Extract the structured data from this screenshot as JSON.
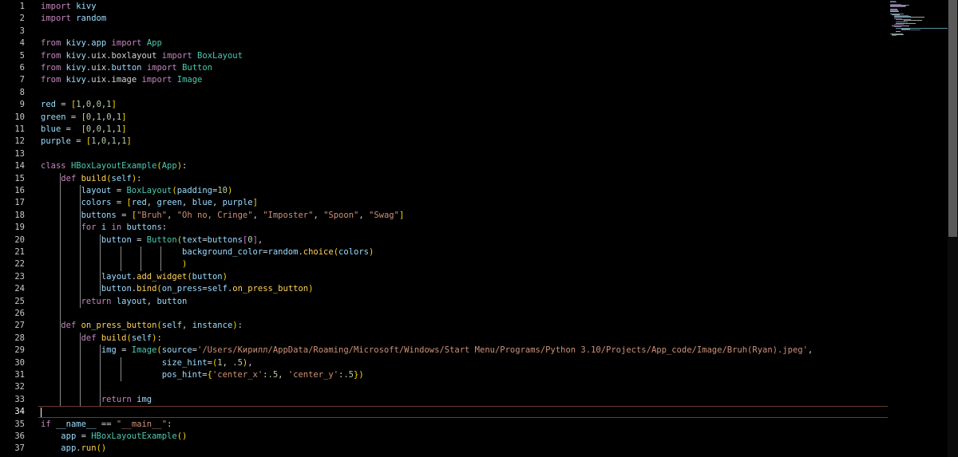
{
  "colors": {
    "background": "#000000",
    "keyword": "#c586c0",
    "function": "#ffd35a",
    "class": "#4ec9b0",
    "variable": "#9cdcfe",
    "number": "#b5cea8",
    "string": "#ce9178",
    "current_line_border": "#6b3a2c"
  },
  "editor": {
    "language": "python",
    "current_line": 34,
    "line_numbers": [
      "1",
      "2",
      "3",
      "4",
      "5",
      "6",
      "7",
      "8",
      "9",
      "10",
      "11",
      "12",
      "13",
      "14",
      "15",
      "16",
      "17",
      "18",
      "19",
      "20",
      "21",
      "22",
      "23",
      "24",
      "25",
      "26",
      "27",
      "28",
      "29",
      "30",
      "31",
      "32",
      "33",
      "34",
      "35",
      "36",
      "37"
    ],
    "lines": [
      "import kivy",
      "import random",
      "",
      "from kivy.app import App",
      "from kivy.uix.boxlayout import BoxLayout",
      "from kivy.uix.button import Button",
      "from kivy.uix.image import Image",
      "",
      "red = [1,0,0,1]",
      "green = [0,1,0,1]",
      "blue =  [0,0,1,1]",
      "purple = [1,0,1,1]",
      "",
      "class HBoxLayoutExample(App):",
      "    def build(self):",
      "        layout = BoxLayout(padding=10)",
      "        colors = [red, green, blue, purple]",
      "        buttons = [\"Bruh\", \"Oh no, Cringe\", \"Imposter\", \"Spoon\", \"Swag\"]",
      "        for i in buttons:",
      "            button = Button(text=buttons[0],",
      "                            background_color=random.choice(colors)",
      "                            )",
      "            layout.add_widget(button)",
      "            button.bind(on_press=self.on_press_button)",
      "        return layout, button",
      "",
      "    def on_press_button(self, instance):",
      "        def build(self):",
      "            img = Image(source='/Users/Кирилл/AppData/Roaming/Microsoft/Windows/Start Menu/Programs/Python 3.10/Projects/App_code/Image/Bruh(Ryan).jpeg',",
      "                        size_hint=(1, .5),",
      "                        pos_hint={'center_x':.5, 'center_y':.5})",
      "",
      "            return img",
      "",
      "if __name__ == \"__main__\":",
      "    app = HBoxLayoutExample()",
      "    app.run()"
    ]
  }
}
